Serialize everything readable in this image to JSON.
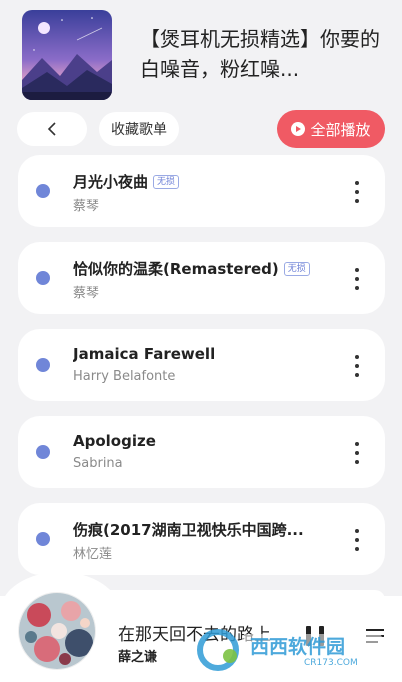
{
  "playlist": {
    "title": "【煲耳机无损精选】你要的白噪音，粉红噪..."
  },
  "actions": {
    "collect_label": "收藏歌单",
    "play_all_label": "全部播放"
  },
  "songs": [
    {
      "title": "月光小夜曲",
      "artist": "蔡琴",
      "badge": "无损"
    },
    {
      "title": "恰似你的温柔(Remastered)",
      "artist": "蔡琴",
      "badge": "无损"
    },
    {
      "title": "Jamaica Farewell",
      "artist": "Harry Belafonte",
      "badge": ""
    },
    {
      "title": "Apologize",
      "artist": "Sabrina",
      "badge": ""
    },
    {
      "title": "伤痕(2017湖南卫视快乐中国跨...",
      "artist": "林忆莲",
      "badge": ""
    }
  ],
  "now_playing": {
    "title": "在那天回不去的路上",
    "artist": "薛之谦"
  },
  "watermark": {
    "brand": "西西软件园",
    "url": "CR173.COM"
  },
  "colors": {
    "accent": "#f05a64",
    "dot": "#7086d8",
    "background": "#f2f2f4"
  }
}
